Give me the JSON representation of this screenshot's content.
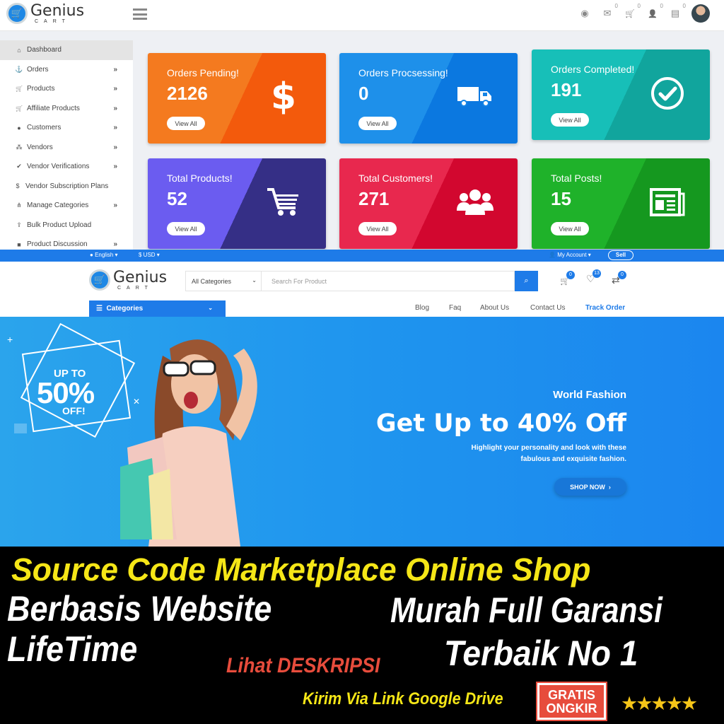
{
  "admin": {
    "logo": {
      "name": "Genius",
      "sub": "CART"
    },
    "top_icons": [
      {
        "name": "globe-icon",
        "glyph": "◉",
        "badge": ""
      },
      {
        "name": "mail-icon",
        "glyph": "✉",
        "badge": "0"
      },
      {
        "name": "cart-icon",
        "glyph": "🛒",
        "badge": "0"
      },
      {
        "name": "user-icon",
        "glyph": "👤",
        "badge": "0"
      },
      {
        "name": "ticket-icon",
        "glyph": "▤",
        "badge": "0"
      }
    ],
    "sidebar": [
      {
        "label": "Dashboard",
        "icon": "⌂",
        "chevron": "",
        "active": true
      },
      {
        "label": "Orders",
        "icon": "⚓",
        "chevron": "»"
      },
      {
        "label": "Products",
        "icon": "🛒",
        "chevron": "»"
      },
      {
        "label": "Affiliate Products",
        "icon": "🛒",
        "chevron": "»"
      },
      {
        "label": "Customers",
        "icon": "●",
        "chevron": "»"
      },
      {
        "label": "Vendors",
        "icon": "⁂",
        "chevron": "»"
      },
      {
        "label": "Vendor Verifications",
        "icon": "✔",
        "chevron": "»"
      },
      {
        "label": "Vendor Subscription Plans",
        "icon": "$",
        "chevron": ""
      },
      {
        "label": "Manage Categories",
        "icon": "⋔",
        "chevron": "»"
      },
      {
        "label": "Bulk Product Upload",
        "icon": "⇪",
        "chevron": ""
      },
      {
        "label": "Product Discussion",
        "icon": "■",
        "chevron": "»"
      }
    ],
    "cards": [
      {
        "title": "Orders Pending!",
        "value": "2126",
        "button": "View All",
        "icon": "dollar-icon",
        "colors": [
          "#f47a1f",
          "#f35a0c"
        ]
      },
      {
        "title": "Orders Procsessing!",
        "value": "0",
        "button": "View All",
        "icon": "truck-icon",
        "colors": [
          "#1e90ea",
          "#0b78e0"
        ]
      },
      {
        "title": "Orders Completed!",
        "value": "191",
        "button": "View All",
        "icon": "check-circle-icon",
        "colors": [
          "#17bfb8",
          "#11a59d"
        ]
      },
      {
        "title": "Total Products!",
        "value": "52",
        "button": "View All",
        "icon": "cart-icon",
        "colors": [
          "#6b5cf0",
          "#352f86"
        ]
      },
      {
        "title": "Total Customers!",
        "value": "271",
        "button": "View All",
        "icon": "users-icon",
        "colors": [
          "#e8284e",
          "#d2072f"
        ]
      },
      {
        "title": "Total Posts!",
        "value": "15",
        "button": "View All",
        "icon": "newspaper-icon",
        "colors": [
          "#1fb22a",
          "#15981f"
        ]
      }
    ]
  },
  "shop": {
    "topbar": {
      "language": "English",
      "currency": "$ USD",
      "account": "My Account",
      "sell": "Sell"
    },
    "logo": {
      "name": "Genius",
      "sub": "CART"
    },
    "category_select": "All Categories",
    "search_placeholder": "Search For Product",
    "header_icons": [
      {
        "name": "cart-icon",
        "glyph": "🛒",
        "badge": "0"
      },
      {
        "name": "heart-icon",
        "glyph": "♡",
        "badge": "13"
      },
      {
        "name": "compare-icon",
        "glyph": "⇄",
        "badge": "0"
      }
    ],
    "categories_button": "Categories",
    "nav_links": [
      "Blog",
      "Faq",
      "About Us",
      "Contact Us",
      "Track Order"
    ],
    "hero": {
      "badge_top": "UP TO",
      "badge_value": "50%",
      "badge_bottom": "OFF!",
      "eyebrow": "World Fashion",
      "headline": "Get Up to 40% Off",
      "sub1": "Highlight your personality and look with these",
      "sub2": "fabulous and exquisite fashion.",
      "cta": "SHOP NOW"
    }
  },
  "banner": {
    "line1": "Source Code Marketplace Online Shop",
    "line2_left": "Berbasis Website",
    "line2_right": "Murah Full Garansi",
    "line3_left": "LifeTime",
    "line3_right": "Terbaik No 1",
    "note": "Lihat DESKRIPSI",
    "delivery": "Kirim Via Link Google Drive",
    "gratis_1": "GRATIS",
    "gratis_2": "ONGKIR",
    "rating_stars": 5,
    "colors": {
      "yellow": "#f5e617",
      "red": "#e74c3c",
      "white": "#ffffff"
    }
  }
}
